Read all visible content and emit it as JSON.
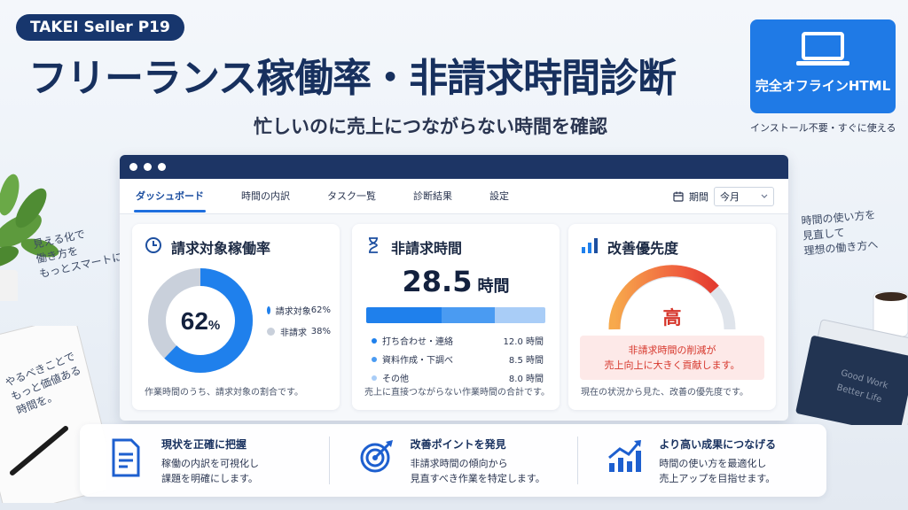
{
  "header": {
    "badge": "TAKEI Seller P19",
    "title": "フリーランス稼働率・非請求時間診断",
    "subtitle": "忙しいのに売上につながらない時間を確認",
    "offline_label": "完全オフラインHTML",
    "offline_sub": "インストール不要・すぐに使える"
  },
  "handwritten": {
    "left": "見える化で\n働き方を\nもっとスマートに",
    "right": "時間の使い方を\n見直して\n理想の働き方へ",
    "note": "やるべきことで\nもっと価値ある\n時間を。",
    "book": "Good Work\nBetter Life"
  },
  "nav": {
    "tabs": [
      {
        "label": "ダッシュボード",
        "active": true
      },
      {
        "label": "時間の内訳"
      },
      {
        "label": "タスク一覧"
      },
      {
        "label": "診断結果"
      },
      {
        "label": "設定"
      }
    ],
    "period_label": "期間",
    "period_value": "今月"
  },
  "billable": {
    "title": "請求対象稼働率",
    "value": "62",
    "unit": "%",
    "fraction": 0.62,
    "legend": [
      {
        "label": "請求対象",
        "value": "62%",
        "color": "#1f80ec"
      },
      {
        "label": "非請求",
        "value": "38%",
        "color": "#c9d0db"
      }
    ],
    "note": "作業時間のうち、請求対象の割合です。"
  },
  "nonbillable": {
    "title": "非請求時間",
    "value": "28.5",
    "unit": "時間",
    "items": [
      {
        "label": "打ち合わせ・連絡",
        "value": "12.0 時間",
        "hours": 12.0,
        "color": "#1f80ec"
      },
      {
        "label": "資料作成・下調べ",
        "value": "8.5 時間",
        "hours": 8.5,
        "color": "#4a9bf2"
      },
      {
        "label": "その他",
        "value": "8.0 時間",
        "hours": 8.0,
        "color": "#a9cdf7"
      }
    ],
    "note": "売上に直接つながらない作業時間の合計です。"
  },
  "priority": {
    "title": "改善優先度",
    "level": "高",
    "message_line1": "非請求時間の削減が",
    "message_line2": "売上向上に大きく貢献します。",
    "note": "現在の状況から見た、改善の優先度です。"
  },
  "features": [
    {
      "title": "現状を正確に把握",
      "desc": "稼働の内訳を可視化し\n課題を明確にします。",
      "icon": "document-icon"
    },
    {
      "title": "改善ポイントを発見",
      "desc": "非請求時間の傾向から\n見直すべき作業を特定します。",
      "icon": "target-icon"
    },
    {
      "title": "より高い成果につなげる",
      "desc": "時間の使い方を最適化し\n売上アップを目指せます。",
      "icon": "growth-chart-icon"
    }
  ],
  "colors": {
    "navy": "#17305e",
    "accent": "#1f80ec",
    "danger": "#d6362b"
  }
}
